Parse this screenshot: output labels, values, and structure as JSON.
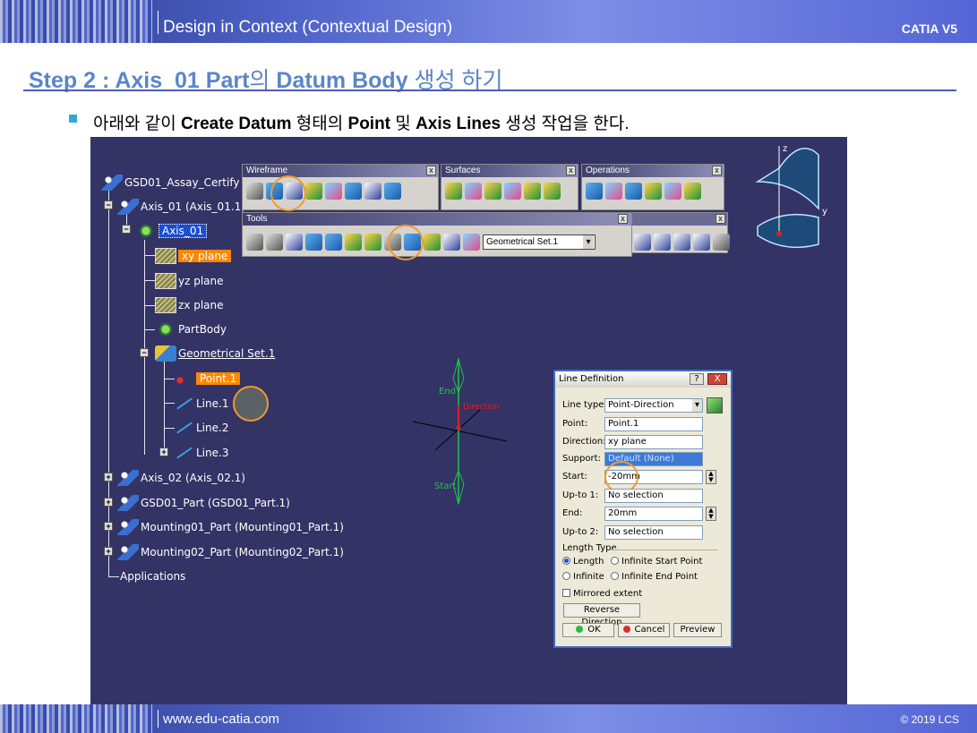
{
  "header": {
    "title": "Design in Context (Contextual Design)",
    "brand": "CATIA V5"
  },
  "footer": {
    "url": "www.edu-catia.com",
    "copyright": "© 2019 LCS"
  },
  "step": {
    "title_bold": "Step 2 : Axis_01 Part",
    "title_light": "의 ",
    "title_bold2": "Datum Body",
    "title_light2": " 생성 하기"
  },
  "instruction": {
    "p1": "아래와 같이 ",
    "b1": "Create Datum",
    "p2": " 형태의 ",
    "b2": "Point",
    "p3": " 및 ",
    "b3": "Axis Lines",
    "p4": " 생성 작업을 한다."
  },
  "tree": {
    "root": "GSD01_Assay_Certify",
    "axis01_product": "Axis_01 (Axis_01.1)",
    "axis01_part": "Axis_01",
    "xy_plane": "xy plane",
    "yz_plane": "yz plane",
    "zx_plane": "zx plane",
    "part_body": "PartBody",
    "geo_set": "Geometrical Set.1",
    "point1": "Point.1",
    "line1": "Line.1",
    "line2": "Line.2",
    "line3": "Line.3",
    "axis02": "Axis_02 (Axis_02.1)",
    "gsd01_part": "GSD01_Part (GSD01_Part.1)",
    "mounting01": "Mounting01_Part (Mounting01_Part.1)",
    "mounting02": "Mounting02_Part (Mounting02_Part.1)",
    "applications": "Applications"
  },
  "toolbars": {
    "wireframe": "Wireframe",
    "surfaces": "Surfaces",
    "operations": "Operations",
    "tools": "Tools",
    "geo_set_combo": "Geometrical Set.1",
    "close": "x"
  },
  "viewer": {
    "end_label": "End",
    "start_label": "Start",
    "direction_label": "Direction",
    "z_label": "z",
    "y_label": "y"
  },
  "dialog": {
    "title": "Line Definition",
    "help": "?",
    "close": "X",
    "line_type_label": "Line type :",
    "line_type_value": "Point-Direction",
    "point_label": "Point:",
    "point_value": "Point.1",
    "direction_label": "Direction:",
    "direction_value": "xy plane",
    "support_label": "Support:",
    "support_value": "Default (None)",
    "start_label": "Start:",
    "start_value": "-20mm",
    "upto1_label": "Up-to 1:",
    "upto1_value": "No selection",
    "end_label": "End:",
    "end_value": "20mm",
    "upto2_label": "Up-to 2:",
    "upto2_value": "No selection",
    "length_type_label": "Length Type",
    "opt_length": "Length",
    "opt_infinite_start": "Infinite Start Point",
    "opt_infinite": "Infinite",
    "opt_infinite_end": "Infinite End Point",
    "mirrored_extent": "Mirrored extent",
    "reverse_direction": "Reverse Direction",
    "ok": "OK",
    "cancel": "Cancel",
    "preview": "Preview"
  }
}
